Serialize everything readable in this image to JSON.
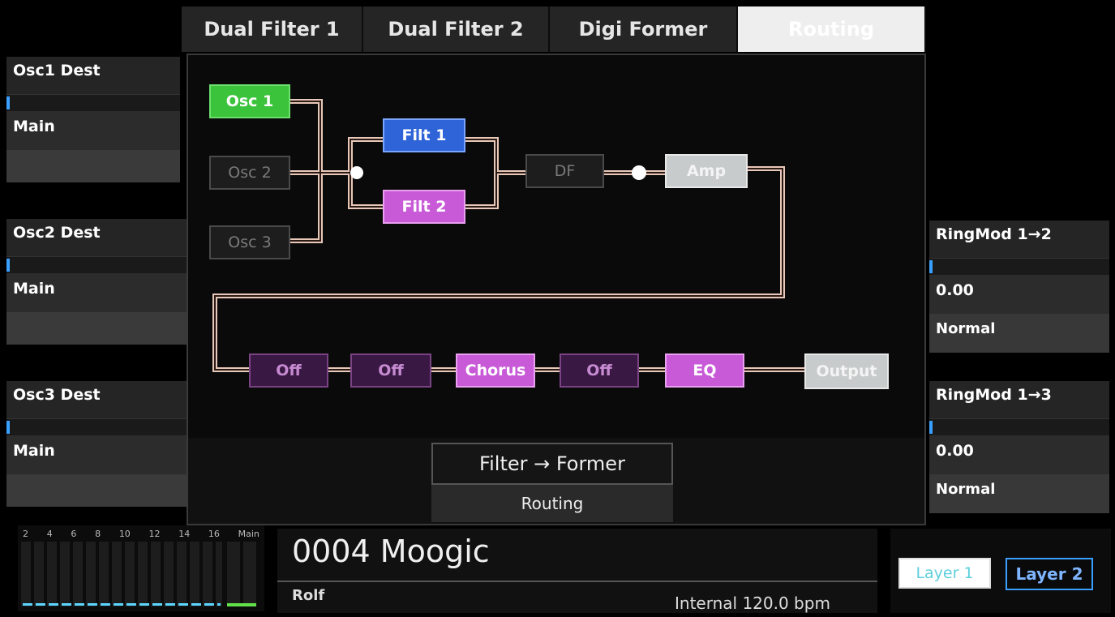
{
  "tabs": [
    "Dual Filter 1",
    "Dual Filter 2",
    "Digi Former",
    "Routing"
  ],
  "left_params": [
    {
      "title": "Osc1 Dest",
      "value": "Main"
    },
    {
      "title": "Osc2 Dest",
      "value": "Main"
    },
    {
      "title": "Osc3 Dest",
      "value": "Main"
    }
  ],
  "right_params": [
    {
      "title": "RingMod 1→2",
      "value": "0.00",
      "mode": "Normal"
    },
    {
      "title": "RingMod 1→3",
      "value": "0.00",
      "mode": "Normal"
    }
  ],
  "routing": {
    "osc1": "Osc 1",
    "osc2": "Osc 2",
    "osc3": "Osc 3",
    "filt1": "Filt 1",
    "filt2": "Filt 2",
    "df": "DF",
    "amp": "Amp",
    "fx": [
      "Off",
      "Off",
      "Chorus",
      "Off",
      "EQ"
    ],
    "output": "Output"
  },
  "center_control": {
    "value": "Filter → Former",
    "label": "Routing"
  },
  "meter": {
    "labels": [
      "2",
      "4",
      "6",
      "8",
      "10",
      "12",
      "14",
      "16",
      "Main"
    ]
  },
  "patch": {
    "name": "0004 Moogic",
    "author": "Rolf",
    "clock": "Internal 120.0 bpm"
  },
  "layers": [
    "Layer 1",
    "Layer 2"
  ],
  "colors": {
    "accent_blue": "#3aa0ff",
    "osc_green": "#3cc33c",
    "filter_blue": "#2f63d8",
    "fx_pink": "#c85ad8"
  }
}
